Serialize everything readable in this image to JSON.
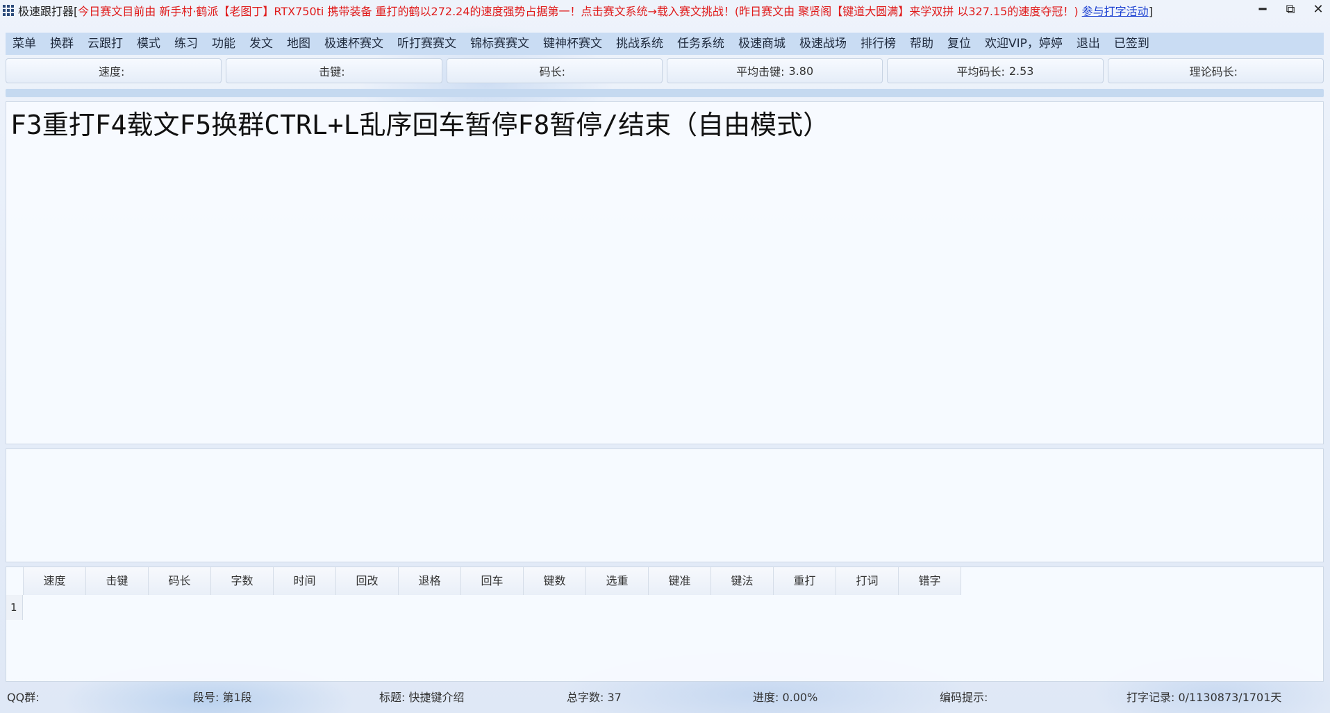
{
  "titlebar": {
    "app_name": "极速跟打器[",
    "notice": "今日赛文目前由 新手村·鹤派【老图丁】RTX750ti 携带装备 重打的鹤以272.24的速度强势占据第一！点击赛文系统→载入赛文挑战！(昨日赛文由 聚贤阁【键道大圆满】来学双拼 以327.15的速度夺冠！)",
    "link": "参与打字活动",
    "close_bracket": "]"
  },
  "window_controls": {
    "minimize": "━",
    "restore": "⧉",
    "close": "✕"
  },
  "menu": [
    "菜单",
    "换群",
    "云跟打",
    "模式",
    "练习",
    "功能",
    "发文",
    "地图",
    "极速杯赛文",
    "听打赛赛文",
    "锦标赛赛文",
    "键神杯赛文",
    "挑战系统",
    "任务系统",
    "极速商城",
    "极速战场",
    "排行榜",
    "帮助",
    "复位",
    "欢迎VIP，婷婷",
    "退出",
    "已签到"
  ],
  "stats": [
    {
      "label": "速度:",
      "value": ""
    },
    {
      "label": "击键:",
      "value": ""
    },
    {
      "label": "码长:",
      "value": ""
    },
    {
      "label": "平均击键:",
      "value": "3.80"
    },
    {
      "label": "平均码长:",
      "value": "2.53"
    },
    {
      "label": "理论码长:",
      "value": ""
    }
  ],
  "article": {
    "text": "F3重打F4载文F5换群CTRL+L乱序回车暂停F8暂停/结束（自由模式）"
  },
  "results": {
    "columns": [
      "速度",
      "击键",
      "码长",
      "字数",
      "时间",
      "回改",
      "退格",
      "回车",
      "键数",
      "选重",
      "键准",
      "键法",
      "重打",
      "打词",
      "错字"
    ],
    "rows": [
      {
        "index": "1"
      }
    ]
  },
  "status": {
    "qq_group": "QQ群:",
    "segment": "段号: 第1段",
    "title": "标题: 快捷键介绍",
    "total_chars": "总字数: 37",
    "progress": "进度: 0.00%",
    "code_hint": "编码提示:",
    "record": "打字记录: 0/1130873/1701天"
  }
}
